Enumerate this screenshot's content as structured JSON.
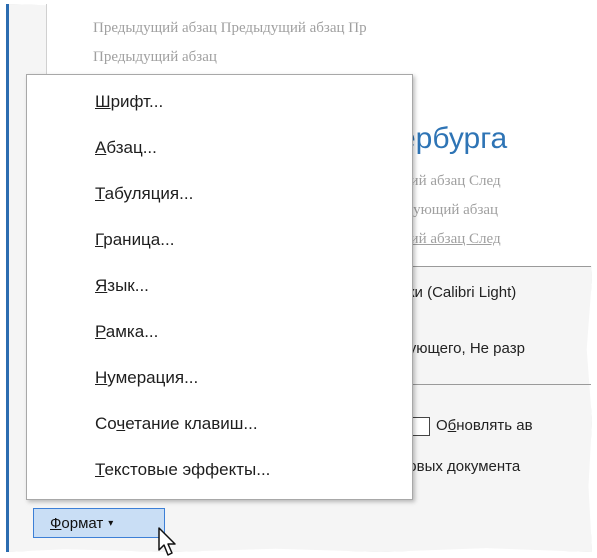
{
  "preview": {
    "prev_line1": "Предыдущий абзац Предыдущий абзац Пр",
    "prev_line2": "Предыдущий абзац",
    "heading_fragment": "ербурга",
    "next_line1": "щий абзац След",
    "next_line2": "едующий абзац",
    "next_line3": "щий абзац След"
  },
  "description": {
    "line1": "вки (Calibri Light)",
    "line2": "дующего, Не разр",
    "line3": "новых документа"
  },
  "checkbox": {
    "label_pre": "О",
    "label_acc": "б",
    "label_post": "новлять ав",
    "checked": false
  },
  "menu": {
    "items": [
      {
        "acc": "Ш",
        "rest": "рифт..."
      },
      {
        "acc": "А",
        "rest": "бзац..."
      },
      {
        "acc": "Т",
        "rest": "абуляция..."
      },
      {
        "acc": "Г",
        "rest": "раница..."
      },
      {
        "acc": "Я",
        "rest": "зык..."
      },
      {
        "acc": "Р",
        "rest": "амка..."
      },
      {
        "acc": "Н",
        "rest": "умерация..."
      },
      {
        "pre": "Со",
        "acc": "ч",
        "rest": "етание клавиш..."
      },
      {
        "acc": "Т",
        "rest": "екстовые эффекты..."
      }
    ]
  },
  "format_button": {
    "acc": "Ф",
    "rest": "ормат",
    "arrow": "▾"
  },
  "colors": {
    "heading_blue": "#2e74b5",
    "button_bg": "#c9def5",
    "button_border": "#3c7fd6"
  }
}
